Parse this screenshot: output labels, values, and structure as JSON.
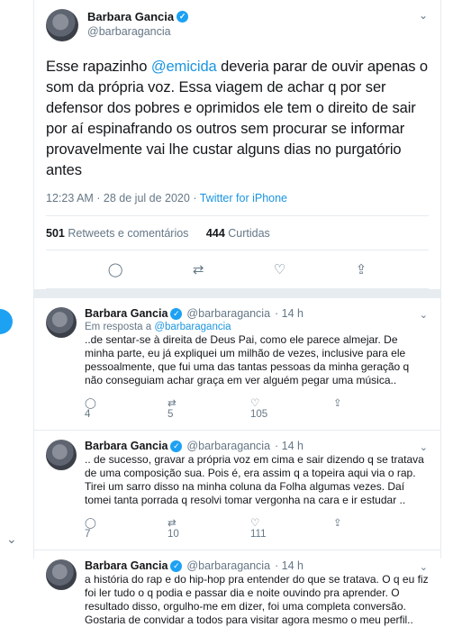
{
  "main": {
    "name": "Barbara Gancia",
    "handle": "@barbaragancia",
    "text_1": "Esse rapazinho ",
    "mention": "@emicida",
    "text_2": " deveria parar de ouvir apenas o som da própria voz. Essa viagem de achar q por ser defensor dos pobres e oprimidos ele tem o direito de sair por aí espinafrando os outros sem procurar se informar provavelmente vai lhe custar alguns dias no purgatório antes",
    "time": "12:23 AM · 28 de jul de 2020",
    "sep": " · ",
    "source": "Twitter for iPhone",
    "retweets": "501",
    "retweets_label": "Retweets e comentários",
    "likes": "444",
    "likes_label": "Curtidas"
  },
  "replies": [
    {
      "name": "Barbara Gancia",
      "handle": "@barbaragancia",
      "time": "· 14 h",
      "in_reply_label": "Em resposta a ",
      "in_reply_to": "@barbaragancia",
      "text": "..de sentar-se à direita de Deus Pai, como ele parece almejar. De minha parte, eu já expliquei um milhão de vezes, inclusive para ele pessoalmente, que fui uma das tantas pessoas da minha geração q não conseguiam achar graça em ver alguém pegar uma música..",
      "replies": "4",
      "retweets": "5",
      "likes": "105"
    },
    {
      "name": "Barbara Gancia",
      "handle": "@barbaragancia",
      "time": "· 14 h",
      "text": ".. de sucesso, gravar a própria voz em cima e sair dizendo q se tratava de uma composição sua. Pois é, era assim q a topeira aqui via o rap. Tirei um sarro disso na minha coluna da Folha algumas vezes. Daí tomei tanta porrada q resolvi tomar vergonha na cara e ir estudar ..",
      "replies": "7",
      "retweets": "10",
      "likes": "111"
    },
    {
      "name": "Barbara Gancia",
      "handle": "@barbaragancia",
      "time": "· 14 h",
      "text": "a história do rap e do hip-hop pra entender do que se tratava. O q eu fiz foi ler tudo o q podia  e passar dia e noite ouvindo pra aprender. O resultado disso, orgulho-me em dizer, foi uma completa conversão. Gostaria de convidar a todos para visitar agora mesmo o meu perfil.."
    }
  ]
}
